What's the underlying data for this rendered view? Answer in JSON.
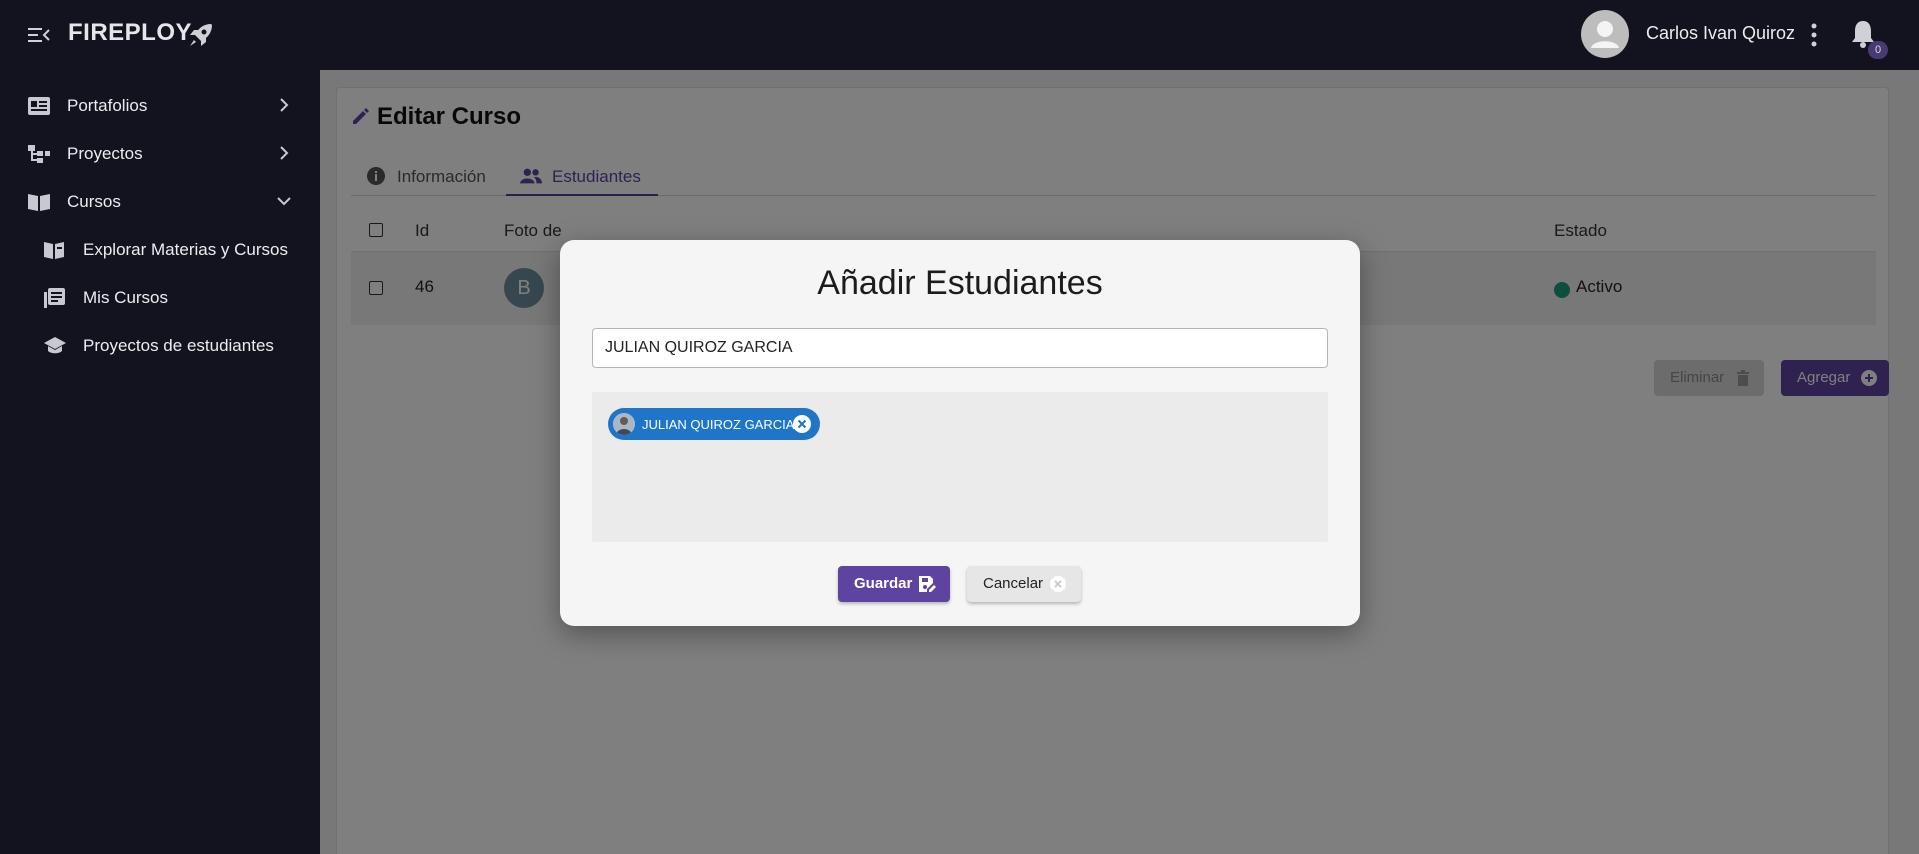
{
  "app": {
    "brand": "FIREPLOY"
  },
  "header": {
    "user_name": "Carlos Ivan Quiroz",
    "notification_count": "0"
  },
  "sidebar": {
    "items": [
      {
        "label": "Portafolios",
        "icon": "portfolio-icon"
      },
      {
        "label": "Proyectos",
        "icon": "project-tree-icon"
      },
      {
        "label": "Cursos",
        "icon": "book-open-icon",
        "expanded": true
      }
    ],
    "sub_items": [
      {
        "label": "Explorar Materias y Cursos",
        "icon": "book-explore-icon"
      },
      {
        "label": "Mis Cursos",
        "icon": "library-icon"
      },
      {
        "label": "Proyectos de estudiantes",
        "icon": "graduation-cap-icon"
      }
    ]
  },
  "page": {
    "title": "Editar Curso",
    "tabs": [
      {
        "label": "Información",
        "icon": "info-icon",
        "active": false
      },
      {
        "label": "Estudiantes",
        "icon": "people-icon",
        "active": true
      }
    ],
    "table": {
      "columns": [
        "Id",
        "Foto de",
        "Estado"
      ],
      "rows": [
        {
          "id": "46",
          "avatar_letter": "B",
          "estado": "Activo"
        }
      ]
    },
    "actions": {
      "delete_label": "Eliminar",
      "add_label": "Agregar"
    }
  },
  "dialog": {
    "title": "Añadir Estudiantes",
    "search_value": "JULIAN QUIROZ GARCIA",
    "chips": [
      {
        "label": "JULIAN QUIROZ GARCIA"
      }
    ],
    "save_label": "Guardar",
    "cancel_label": "Cancelar"
  },
  "colors": {
    "primary": "#5e44a0",
    "chip": "#1f76c8",
    "status_active": "#1d9c7e",
    "sidebar_bg": "#13131f"
  }
}
